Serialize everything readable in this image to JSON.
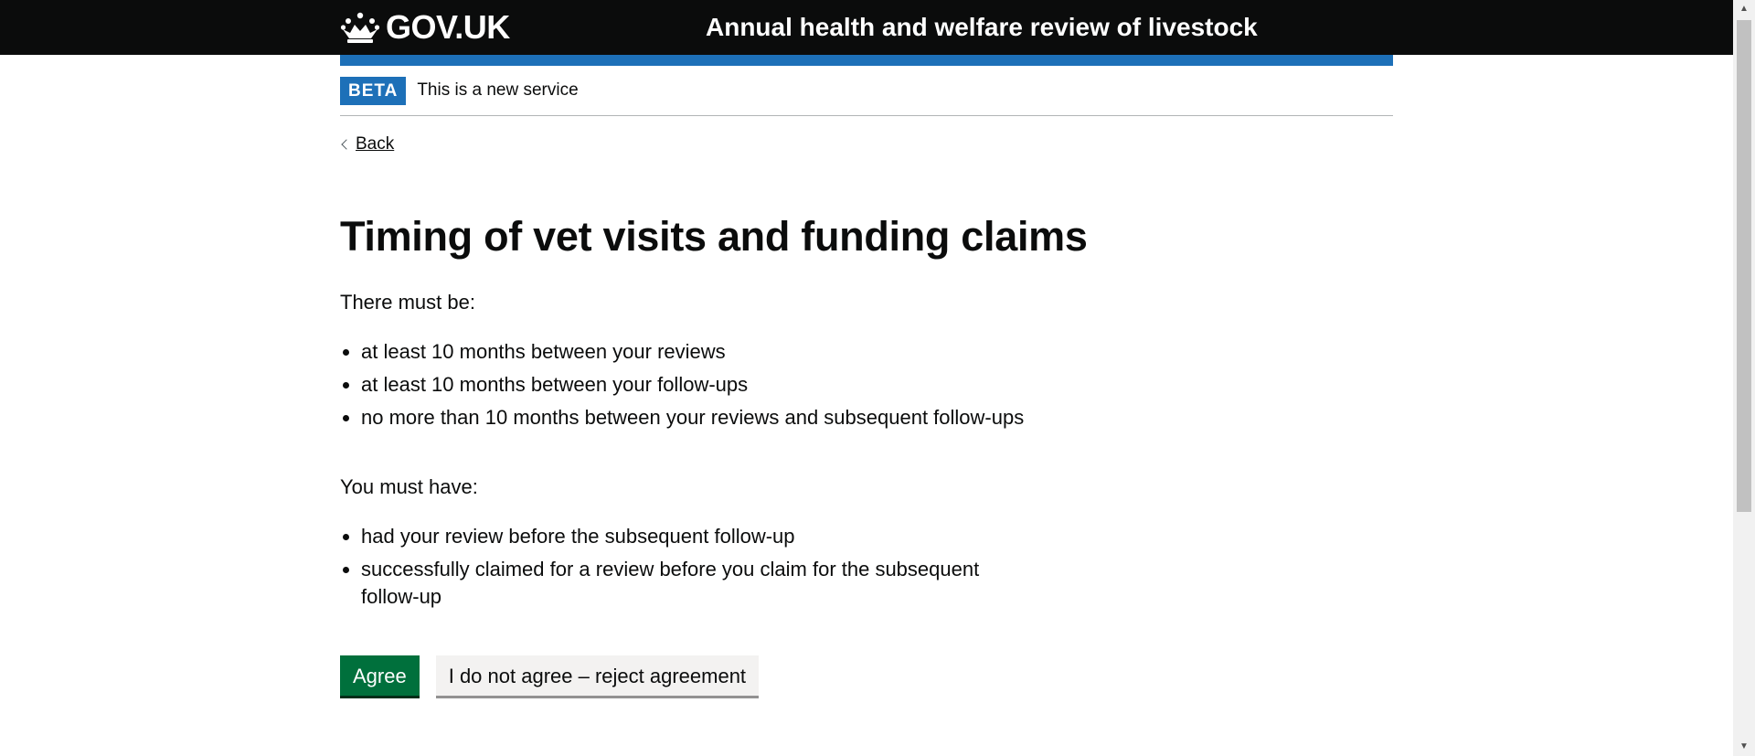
{
  "header": {
    "logo_text": "GOV.UK",
    "service_name": "Annual health and welfare review of livestock"
  },
  "phase_banner": {
    "tag": "BETA",
    "text": "This is a new service"
  },
  "back_link": "Back",
  "main": {
    "title": "Timing of vet visits and funding claims",
    "intro_1": "There must be:",
    "list_1": [
      "at least 10 months between your reviews",
      "at least 10 months between your follow-ups",
      "no more than 10 months between your reviews and subsequent follow-ups"
    ],
    "intro_2": "You must have:",
    "list_2": [
      "had your review before the subsequent follow-up",
      "successfully claimed for a review before you claim for the subsequent follow-up"
    ]
  },
  "buttons": {
    "agree": "Agree",
    "reject": "I do not agree – reject agreement"
  },
  "colors": {
    "header_bg": "#0b0c0c",
    "brand_blue": "#1d70b8",
    "primary_button": "#00703c",
    "secondary_button": "#f3f2f1"
  }
}
